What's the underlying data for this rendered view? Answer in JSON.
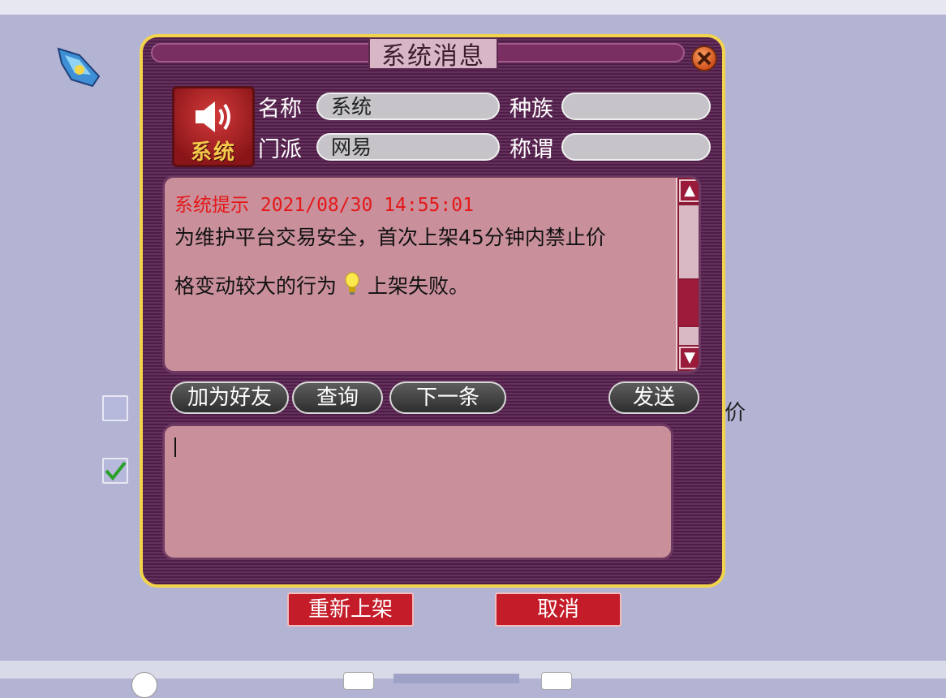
{
  "dialog": {
    "title": "系统消息",
    "avatar_label": "系统",
    "fields": {
      "name_label": "名称",
      "name_value": "系统",
      "race_label": "种族",
      "race_value": "",
      "sect_label": "门派",
      "sect_value": "网易",
      "title_label": "称谓",
      "title_value": ""
    },
    "message": {
      "header": "系统提示 2021/08/30 14:55:01",
      "line1": "为维护平台交易安全，首次上架45分钟内禁止价",
      "line2_before": "格变动较大的行为",
      "line2_after": "上架失败。"
    },
    "buttons": {
      "add_friend": "加为好友",
      "query": "查询",
      "next": "下一条",
      "send": "发送"
    },
    "input_value": ""
  },
  "page": {
    "price_label": "价",
    "relist_label": "重新上架",
    "cancel_label": "取消"
  },
  "colors": {
    "background": "#b3b4d4",
    "dialog_border": "#f2d44c",
    "dialog_bg": "#4e1d47",
    "panel_pink": "#c9909c",
    "header_red": "#e41818",
    "button_red": "#c41c28"
  },
  "icons": [
    "gem-icon",
    "close-icon",
    "speaker-icon",
    "lightbulb-icon",
    "checkmark-icon",
    "scroll-up-icon",
    "scroll-down-icon"
  ]
}
